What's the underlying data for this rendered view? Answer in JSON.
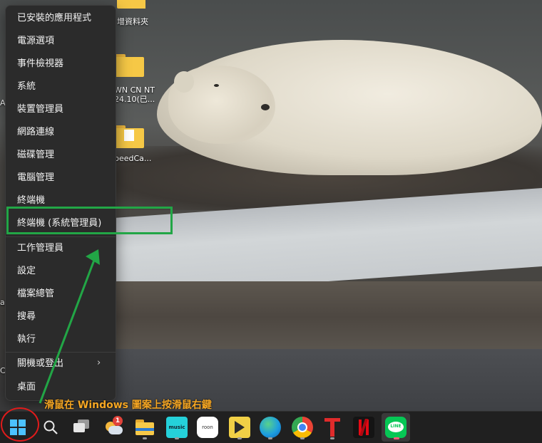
{
  "desktop": {
    "icons": [
      {
        "label": "增資料夾"
      },
      {
        "label": "WN CN NT",
        "label2": "24.10(已..."
      },
      {
        "label": "peedCa..."
      }
    ],
    "edge_letters": [
      "A",
      "ai",
      "C"
    ]
  },
  "menu": {
    "items": [
      {
        "label": "已安裝的應用程式"
      },
      {
        "label": "電源選項"
      },
      {
        "label": "事件檢視器"
      },
      {
        "label": "系統"
      },
      {
        "label": "裝置管理員"
      },
      {
        "label": "網路連線"
      },
      {
        "label": "磁碟管理"
      },
      {
        "label": "電腦管理"
      },
      {
        "label": "終端機"
      },
      {
        "label": "終端機 (系統管理員)"
      },
      {
        "label": "工作管理員"
      },
      {
        "label": "設定"
      },
      {
        "label": "檔案總管"
      },
      {
        "label": "搜尋"
      },
      {
        "label": "執行"
      },
      {
        "label": "關機或登出"
      },
      {
        "label": "桌面"
      }
    ],
    "submenu_chevron": "›"
  },
  "annotation": {
    "text": "滑鼠在 Windows 圖案上按滑鼠右鍵",
    "highlight_color": "#22a646",
    "text_color": "#f5a623",
    "circle_color": "#e11b1b"
  },
  "taskbar": {
    "weather_badge": "1",
    "amazon_music_label": "music",
    "roon_label": "roon",
    "line_label": "LINE",
    "apps": [
      "start-icon",
      "search-icon",
      "task-view-icon",
      "widgets-icon",
      "file-explorer-icon",
      "amazon-music-icon",
      "roon-icon",
      "potplayer-icon",
      "edge-icon",
      "chrome-icon",
      "typora-icon",
      "netflix-icon",
      "line-icon"
    ]
  }
}
